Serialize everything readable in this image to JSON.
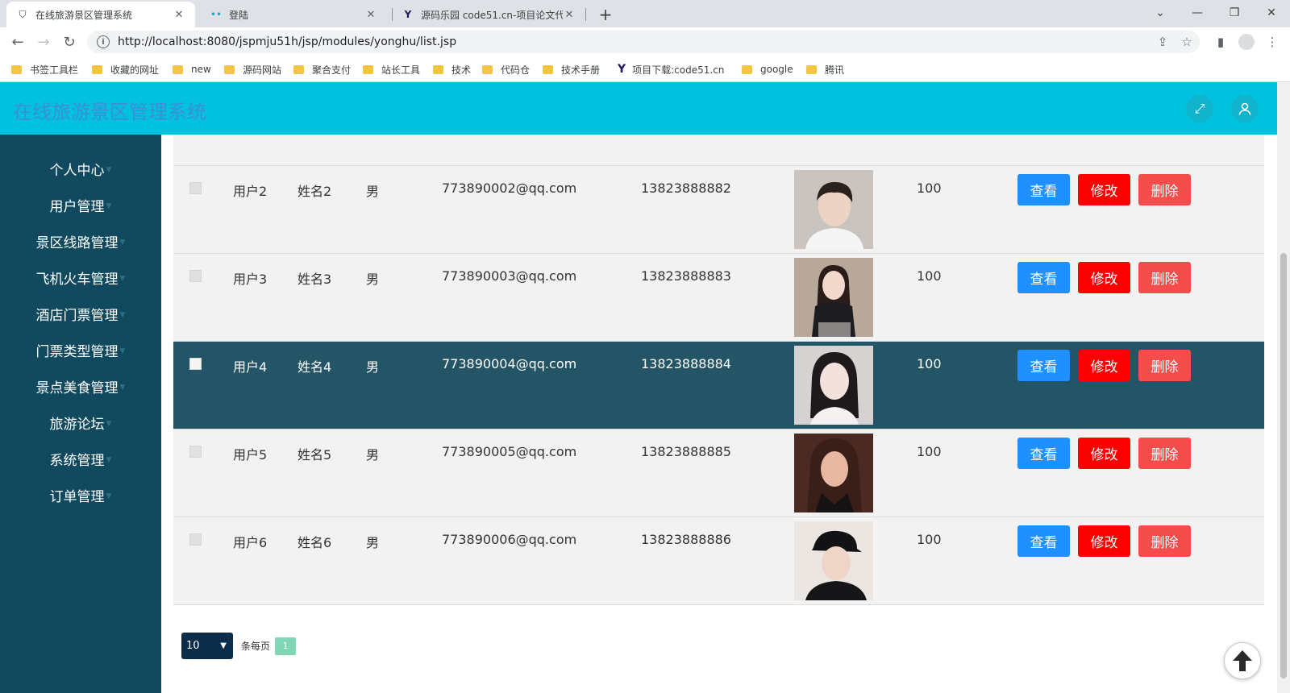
{
  "browser": {
    "tabs": [
      {
        "title": "在线旅游景区管理系统",
        "active": true
      },
      {
        "title": "登陆",
        "active": false
      },
      {
        "title": "源码乐园 code51.cn-项目论文代",
        "active": false
      }
    ],
    "url": "http://localhost:8080/jspmju51h/jsp/modules/yonghu/list.jsp",
    "bookmarks": [
      "书签工具栏",
      "收藏的网址",
      "new",
      "源码网站",
      "聚合支付",
      "站长工具",
      "技术",
      "代码仓",
      "技术手册",
      "项目下载:code51.cn",
      "google",
      "腾讯"
    ]
  },
  "app": {
    "title": "在线旅游景区管理系统",
    "brand_color": "#00c2de",
    "sidebar_color": "#114a5e"
  },
  "sidebar": {
    "items": [
      "个人中心",
      "用户管理",
      "景区线路管理",
      "飞机火车管理",
      "酒店门票管理",
      "门票类型管理",
      "景点美食管理",
      "旅游论坛",
      "系统管理",
      "订单管理"
    ]
  },
  "table": {
    "rows": [
      {
        "account": "用户2",
        "name": "姓名2",
        "gender": "男",
        "email": "773890002@qq.com",
        "phone": "13823888882",
        "balance": "100",
        "highlighted": false
      },
      {
        "account": "用户3",
        "name": "姓名3",
        "gender": "男",
        "email": "773890003@qq.com",
        "phone": "13823888883",
        "balance": "100",
        "highlighted": false
      },
      {
        "account": "用户4",
        "name": "姓名4",
        "gender": "男",
        "email": "773890004@qq.com",
        "phone": "13823888884",
        "balance": "100",
        "highlighted": true
      },
      {
        "account": "用户5",
        "name": "姓名5",
        "gender": "男",
        "email": "773890005@qq.com",
        "phone": "13823888885",
        "balance": "100",
        "highlighted": false
      },
      {
        "account": "用户6",
        "name": "姓名6",
        "gender": "男",
        "email": "773890006@qq.com",
        "phone": "13823888886",
        "balance": "100",
        "highlighted": false
      }
    ],
    "actions": {
      "view": "查看",
      "edit": "修改",
      "delete": "删除"
    }
  },
  "pagination": {
    "page_size": "10",
    "per_page_label": "条每页",
    "current_page": "1"
  }
}
